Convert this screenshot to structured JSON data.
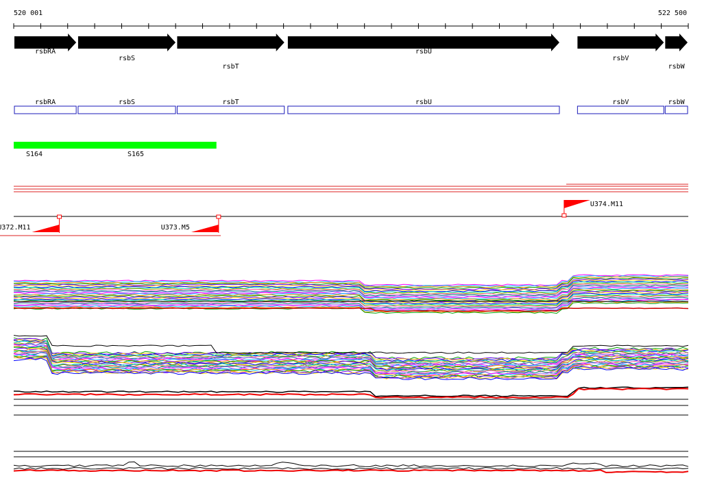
{
  "ruler": {
    "start_label": "520 001",
    "end_label": "522 500",
    "start": 520001,
    "end": 522500
  },
  "genes": [
    {
      "name": "rsbRA",
      "start": 520001,
      "end": 520235
    },
    {
      "name": "rsbS",
      "start": 520237,
      "end": 520603
    },
    {
      "name": "rsbT",
      "start": 520604,
      "end": 521006
    },
    {
      "name": "rsbU",
      "start": 521014,
      "end": 522025
    },
    {
      "name": "rsbV",
      "start": 522087,
      "end": 522412
    },
    {
      "name": "rsbW",
      "start": 522412,
      "end": 522500
    }
  ],
  "segments": [
    {
      "name": "S164",
      "start": 520001,
      "end": 520752
    },
    {
      "name": "S165",
      "start": 520001,
      "end": 520752
    }
  ],
  "promoters": [
    {
      "name": "U372.M11",
      "position": 520170,
      "strand": "-"
    },
    {
      "name": "U373.M5",
      "position": 520760,
      "strand": "-"
    },
    {
      "name": "U374.M11",
      "position": 522040,
      "strand": "+"
    }
  ],
  "colors": {
    "gene_arrow": "#000000",
    "gene_box": "#1a1ab8",
    "segment": "#00ff00",
    "promoter": "#ff0000",
    "profile_palette": [
      "#ff00ff",
      "#00c0ff",
      "#ff8800",
      "#00a000",
      "#8000ff",
      "#ffd000",
      "#0000ff",
      "#00e0a0",
      "#a0a000",
      "#ff66cc",
      "#008080",
      "#9966ff"
    ]
  }
}
